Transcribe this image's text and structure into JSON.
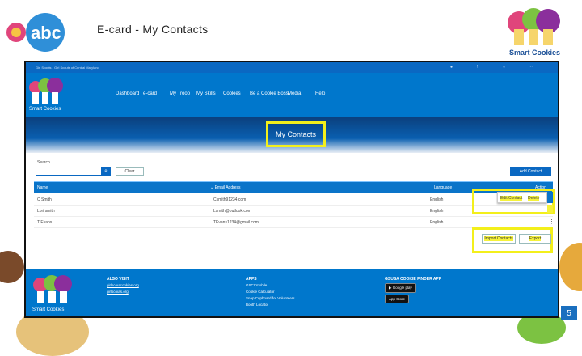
{
  "slide": {
    "title": "E-card - My Contacts",
    "page_number": "5",
    "logo_text": "abc",
    "brand_logo_text": "Smart Cookies"
  },
  "browser": {
    "tab_title": "Girl Scouts - Girl Scouts of Central Maryland"
  },
  "nav": {
    "logo_text": "Smart Cookies",
    "items": [
      "Dashboard",
      "e-card",
      "My Troop",
      "My Skills",
      "Cookies",
      "Be a Cookie Boss",
      "Media",
      "Help"
    ]
  },
  "banner": {
    "title": "My Contacts"
  },
  "search": {
    "label": "Search",
    "value": "",
    "clear_label": "Clear",
    "add_contact_label": "Add Contact"
  },
  "table": {
    "headers": [
      "Name",
      "Email Address",
      "Language",
      "Action"
    ],
    "rows": [
      {
        "name": "C Smith",
        "email": "Csmith91234.com",
        "language": "English"
      },
      {
        "name": "Lori smith",
        "email": "Lsmith@outlook.com",
        "language": "English"
      },
      {
        "name": "T Evans",
        "email": "TEvans1234@gmail.com",
        "language": "English"
      }
    ],
    "row_menu": {
      "edit": "Edit Contact",
      "delete": "Delete"
    },
    "import_label": "Import Contacts",
    "export_label": "Export"
  },
  "footer": {
    "also_visit": {
      "heading": "ALSO VISIT",
      "links": [
        "girlscoutcookies.org",
        "girlscouts.org"
      ]
    },
    "apps": {
      "heading": "APPS",
      "links": [
        "GSCCmobile",
        "Cookie Calculator",
        "Snap Cupboard for Volunteers",
        "Booth Locator"
      ]
    },
    "finder": {
      "heading": "GSUSA COOKIE FINDER APP",
      "google": "Google play",
      "apple": "App Store"
    }
  },
  "colors": {
    "brand_blue": "#0077cc",
    "highlight": "#f3ef1b"
  }
}
